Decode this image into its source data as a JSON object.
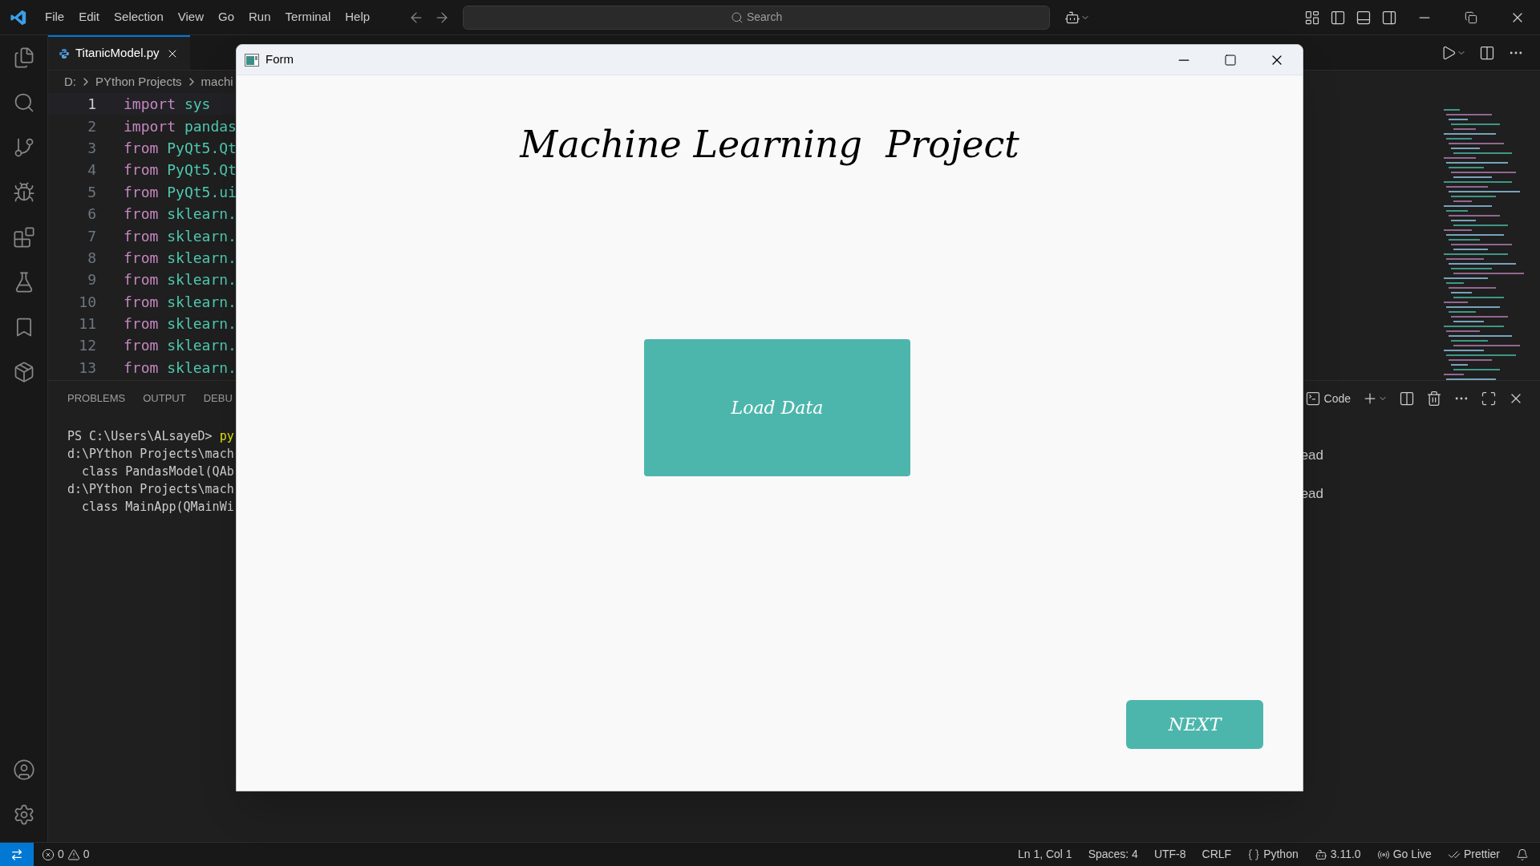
{
  "menu": [
    "File",
    "Edit",
    "Selection",
    "View",
    "Go",
    "Run",
    "Terminal",
    "Help"
  ],
  "search": {
    "placeholder": "Search"
  },
  "editor_tab": {
    "label": "TitanicModel.py",
    "selected": true
  },
  "breadcrumb": [
    "D:",
    "PYthon Projects",
    "machi"
  ],
  "code_lines": [
    {
      "number": "1",
      "keyword": "import",
      "rest": "sys",
      "current": true
    },
    {
      "number": "2",
      "keyword": "import",
      "rest": "pandas",
      "current": false
    },
    {
      "number": "3",
      "keyword": "from",
      "rest": "PyQt5.Qt",
      "current": false
    },
    {
      "number": "4",
      "keyword": "from",
      "rest": "PyQt5.Qt",
      "current": false
    },
    {
      "number": "5",
      "keyword": "from",
      "rest": "PyQt5.ui",
      "current": false
    },
    {
      "number": "6",
      "keyword": "from",
      "rest": "sklearn.",
      "current": false
    },
    {
      "number": "7",
      "keyword": "from",
      "rest": "sklearn.",
      "current": false
    },
    {
      "number": "8",
      "keyword": "from",
      "rest": "sklearn.",
      "current": false
    },
    {
      "number": "9",
      "keyword": "from",
      "rest": "sklearn.",
      "current": false
    },
    {
      "number": "10",
      "keyword": "from",
      "rest": "sklearn.",
      "current": false
    },
    {
      "number": "11",
      "keyword": "from",
      "rest": "sklearn.",
      "current": false
    },
    {
      "number": "12",
      "keyword": "from",
      "rest": "sklearn.",
      "current": false
    },
    {
      "number": "13",
      "keyword": "from",
      "rest": "sklearn.",
      "current": false
    }
  ],
  "panel_tabs": [
    "PROBLEMS",
    "OUTPUT",
    "DEBU"
  ],
  "terminal_lines": [
    {
      "text": "PS C:\\Users\\ALsayeD> ",
      "command": "py"
    },
    {
      "text": "d:\\PYthon Projects\\mach"
    },
    {
      "text": "  class PandasModel(QAb"
    },
    {
      "text": "d:\\PYthon Projects\\mach"
    },
    {
      "text": "  class MainApp(QMainWi"
    }
  ],
  "terminal_toolbar": {
    "label": "Code"
  },
  "terminal_right": [
    "ead",
    "ead"
  ],
  "status_bar": {
    "errors": "0",
    "warnings": "0",
    "items": [
      "Ln 1, Col 1",
      "Spaces: 4",
      "UTF-8",
      "CRLF",
      "Python",
      "3.11.0",
      "Go Live",
      "Prettier"
    ]
  },
  "form": {
    "title": "Form",
    "heading": "Machine Learning  Project",
    "buttons": [
      "Load Data",
      "NEXT"
    ]
  }
}
